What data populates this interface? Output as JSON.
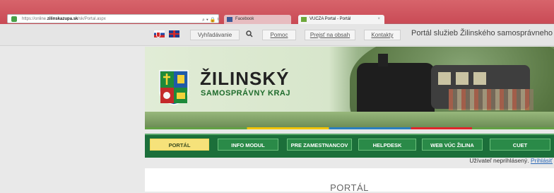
{
  "browser": {
    "url_prefix": "https://online.",
    "url_domain": "zilinskazupa.sk",
    "url_path": "/sk/Portal.aspx",
    "tabs": [
      {
        "label": "Facebook",
        "icon": "facebook-icon"
      },
      {
        "label": "VUCZA Portal - Portál",
        "icon": "vucza-icon",
        "close": "×"
      }
    ]
  },
  "header": {
    "search_label": "Vyhľadávanie",
    "buttons": [
      "Pomoc",
      "Prejsť na obsah",
      "Kontakty"
    ],
    "portal_title": "Portál služieb Žilinského samosprávneho kraja"
  },
  "logo": {
    "main": "ŽILINSKÝ",
    "sub": "SAMOSPRÁVNY KRAJ"
  },
  "menu": {
    "items": [
      "PORTÁL",
      "INFO MODUL",
      "PRE ZAMESTNANCOV",
      "HELPDESK",
      "WEB VÚC ŽILINA",
      "CUET"
    ],
    "active": 0
  },
  "user": {
    "status_text": "Užívateľ neprihlásený.",
    "login_link": "Prihlásiť"
  },
  "content": {
    "title": "PORTÁL"
  },
  "colors": {
    "browser_bar": "#c94a55",
    "menu_bg": "#1c6f3a",
    "menu_active": "#f6e27a",
    "link": "#2a68b6"
  }
}
